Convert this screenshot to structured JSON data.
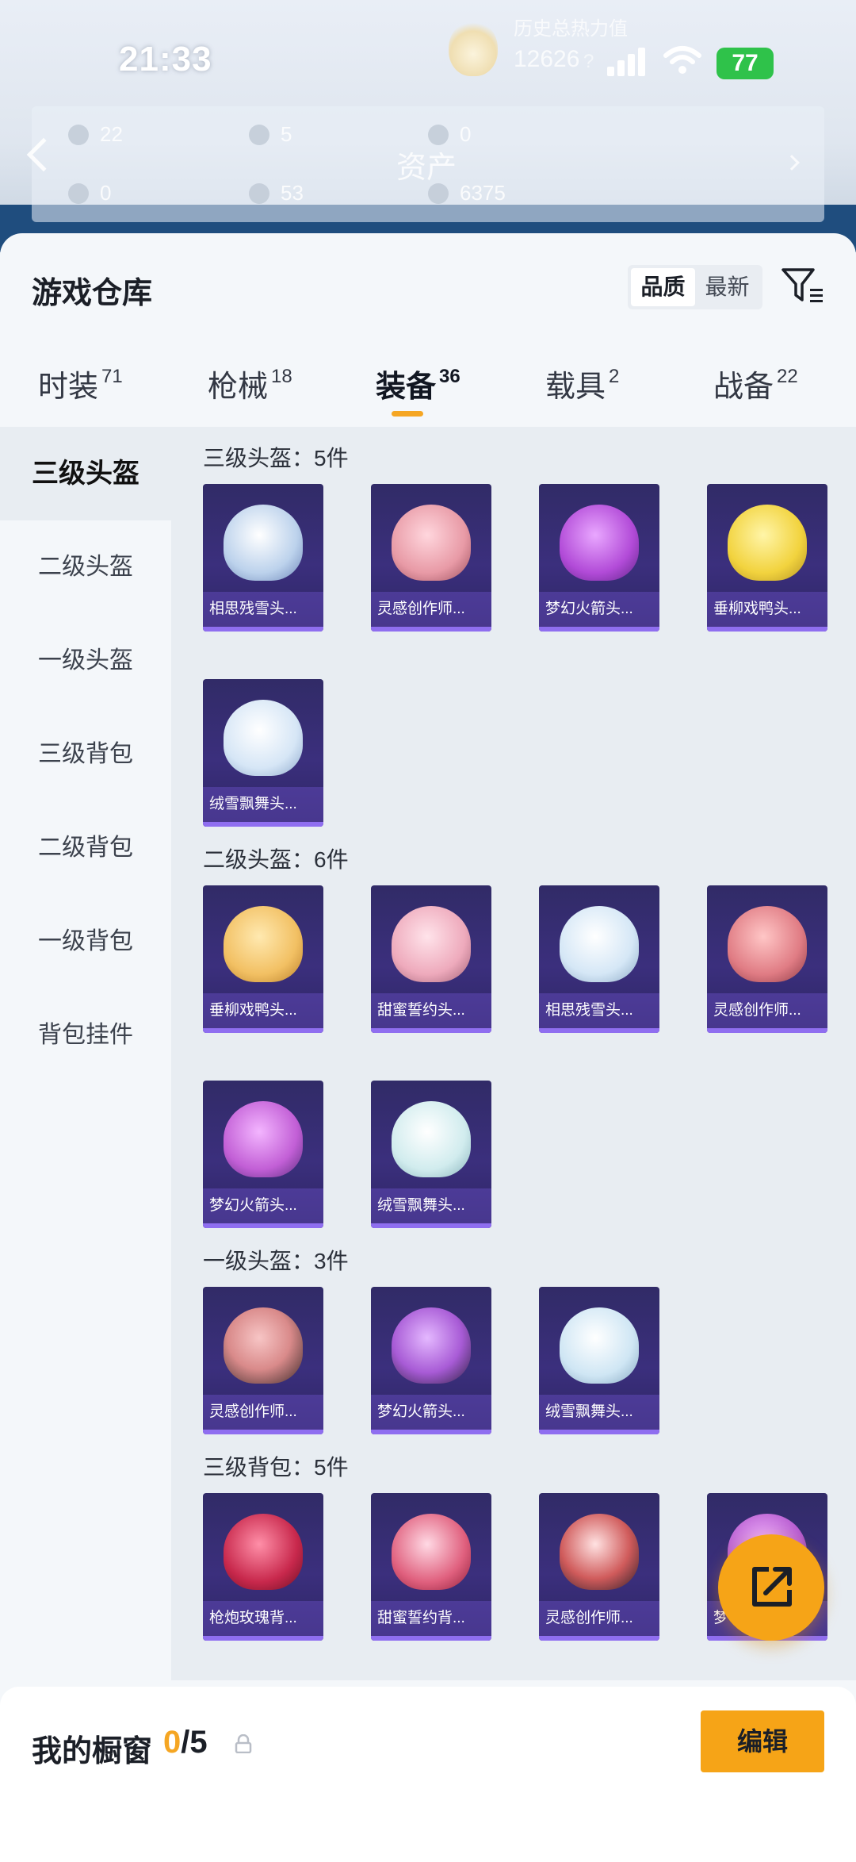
{
  "status": {
    "time": "21:33",
    "heat_label": "历史总热力值",
    "heat_value": "12626",
    "battery": "77"
  },
  "assets": {
    "title": "资产",
    "items": [
      "22",
      "5",
      "0",
      "0",
      "53",
      "6375"
    ]
  },
  "warehouse": {
    "title": "游戏仓库",
    "sort": [
      "品质",
      "最新"
    ],
    "tabs": [
      {
        "label": "时装",
        "count": "71"
      },
      {
        "label": "枪械",
        "count": "18"
      },
      {
        "label": "装备",
        "count": "36"
      },
      {
        "label": "载具",
        "count": "2"
      },
      {
        "label": "战备",
        "count": "22"
      }
    ],
    "categories": [
      "三级头盔",
      "二级头盔",
      "一级头盔",
      "三级背包",
      "二级背包",
      "一级背包",
      "背包挂件"
    ],
    "groups": [
      {
        "title": "三级头盔：5件",
        "items": [
          "相思残雪头...",
          "灵感创作师...",
          "梦幻火箭头...",
          "垂柳戏鸭头...",
          "绒雪飘舞头..."
        ]
      },
      {
        "title": "二级头盔：6件",
        "items": [
          "垂柳戏鸭头...",
          "甜蜜誓约头...",
          "相思残雪头...",
          "灵感创作师...",
          "梦幻火箭头...",
          "绒雪飘舞头..."
        ]
      },
      {
        "title": "一级头盔：3件",
        "items": [
          "灵感创作师...",
          "梦幻火箭头...",
          "绒雪飘舞头..."
        ]
      },
      {
        "title": "三级背包：5件",
        "items": [
          "枪炮玫瑰背...",
          "甜蜜誓约背...",
          "灵感创作师...",
          "梦"
        ]
      }
    ]
  },
  "showcase": {
    "title": "我的橱窗",
    "current": "0",
    "total": "/5",
    "edit_label": "编辑"
  },
  "colors": {
    "accent": "#f6a417",
    "card_bg": "#342c70",
    "card_bar": "#8f6ef0"
  }
}
